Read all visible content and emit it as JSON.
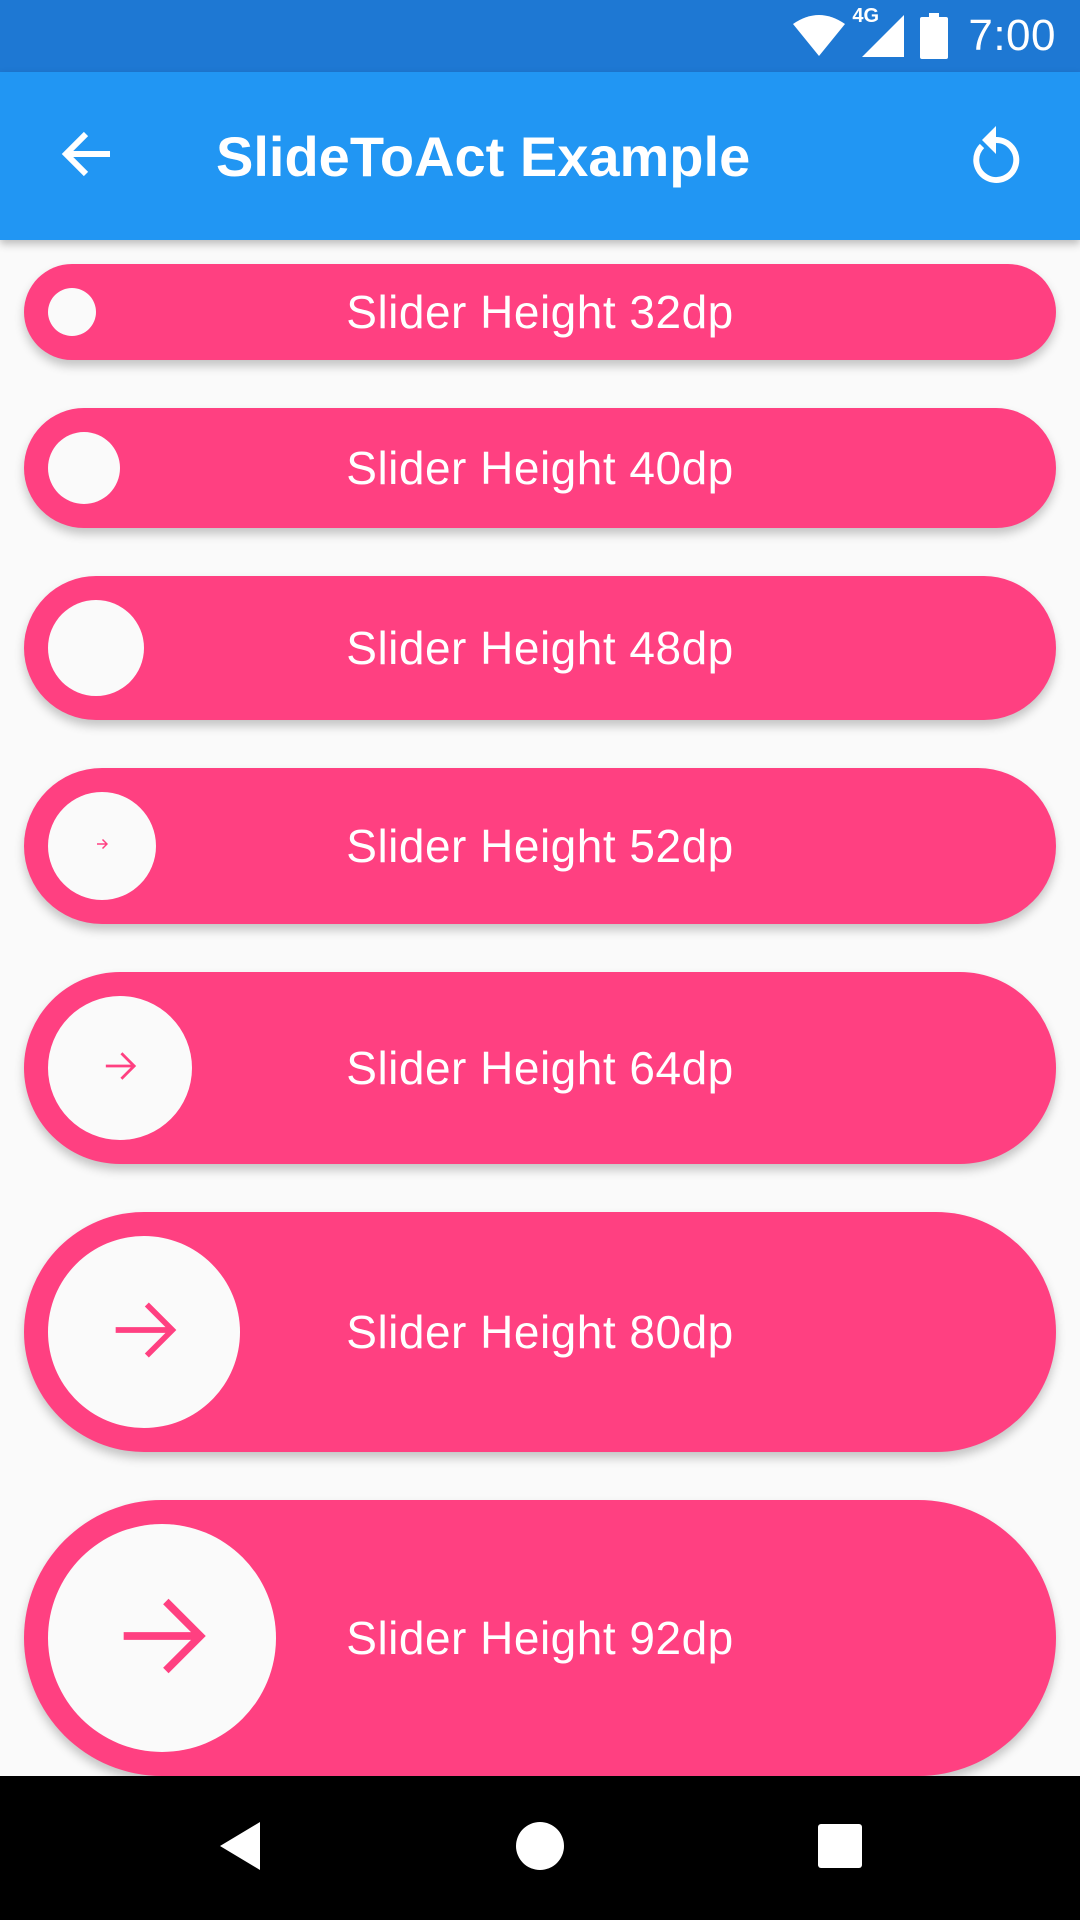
{
  "status_bar": {
    "time": "7:00",
    "network": "4G",
    "icons": [
      "wifi-icon",
      "cellular-signal-icon",
      "battery-icon"
    ]
  },
  "app_bar": {
    "title": "SlideToAct Example",
    "back_icon": "arrow-back-icon",
    "reset_icon": "reset-icon"
  },
  "sliders": [
    {
      "label": "Slider Height 32dp",
      "height_dp": 32
    },
    {
      "label": "Slider Height 40dp",
      "height_dp": 40
    },
    {
      "label": "Slider Height 48dp",
      "height_dp": 48
    },
    {
      "label": "Slider Height 52dp",
      "height_dp": 52
    },
    {
      "label": "Slider Height 64dp",
      "height_dp": 64
    },
    {
      "label": "Slider Height 80dp",
      "height_dp": 80
    },
    {
      "label": "Slider Height 92dp",
      "height_dp": 92
    }
  ],
  "colors": {
    "status_bar": "#1E78D3",
    "app_bar": "#2196F3",
    "slider": "#FF4081",
    "knob": "#FAFAFA",
    "background": "#FAFAFA"
  },
  "nav_bar": {
    "icons": [
      "back-triangle-icon",
      "home-circle-icon",
      "recents-square-icon"
    ]
  }
}
